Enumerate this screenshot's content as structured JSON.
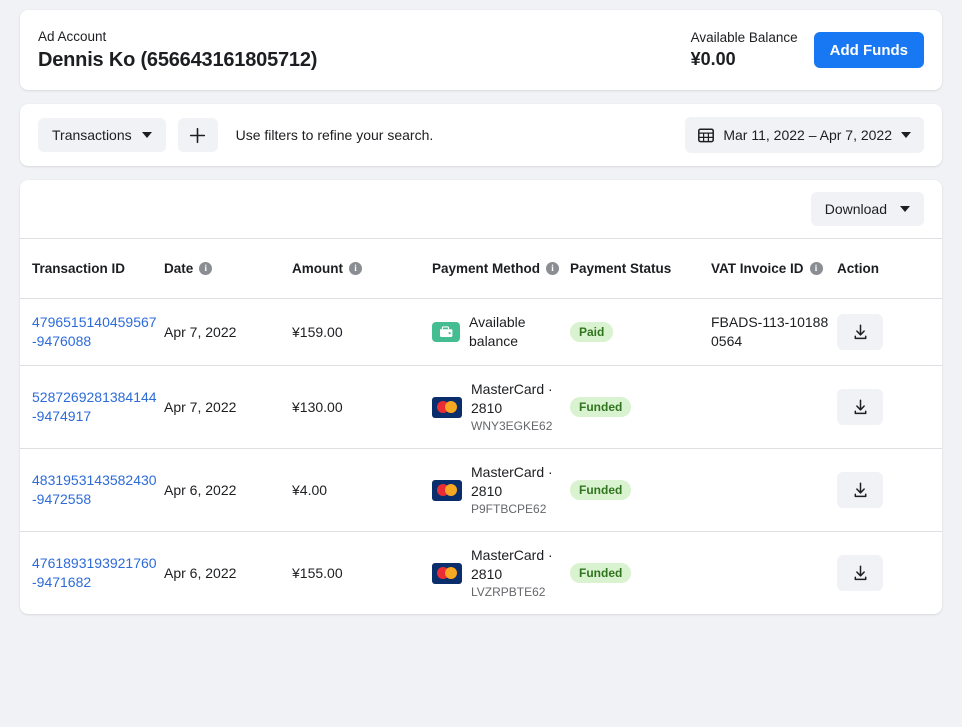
{
  "account": {
    "label": "Ad Account",
    "name": "Dennis Ko (656643161805712)",
    "balance_label": "Available Balance",
    "balance_value": "¥0.00",
    "add_funds_label": "Add Funds",
    "accent_color": "#1877f2"
  },
  "filters": {
    "type_label": "Transactions",
    "add_filter_icon": "plus-icon",
    "hint": "Use filters to refine your search.",
    "date_range": "Mar 11, 2022 – Apr 7, 2022",
    "calendar_icon": "calendar-icon"
  },
  "table": {
    "download_label": "Download",
    "columns": [
      {
        "label": "Transaction ID",
        "info": false
      },
      {
        "label": "Date",
        "info": true
      },
      {
        "label": "Amount",
        "info": true
      },
      {
        "label": "Payment Method",
        "info": true
      },
      {
        "label": "Payment Status",
        "info": false
      },
      {
        "label": "VAT Invoice ID",
        "info": true
      },
      {
        "label": "Action",
        "info": false
      }
    ],
    "info_glyph": "i",
    "action_icon": "download-icon",
    "rows": [
      {
        "transaction_id": "4796515140459567-9476088",
        "date": "Apr 7, 2022",
        "amount": "¥159.00",
        "method_icon": "wallet-icon",
        "method_name": "Available balance",
        "method_ref": "",
        "status": "Paid",
        "status_color": "#317520",
        "vat_invoice_id": "FBADS-113-101880564"
      },
      {
        "transaction_id": "5287269281384144-9474917",
        "date": "Apr 7, 2022",
        "amount": "¥130.00",
        "method_icon": "mastercard-icon",
        "method_name": "MasterCard · 2810",
        "method_ref": "WNY3EGKE62",
        "status": "Funded",
        "status_color": "#317520",
        "vat_invoice_id": ""
      },
      {
        "transaction_id": "4831953143582430-9472558",
        "date": "Apr 6, 2022",
        "amount": "¥4.00",
        "method_icon": "mastercard-icon",
        "method_name": "MasterCard · 2810",
        "method_ref": "P9FTBCPE62",
        "status": "Funded",
        "status_color": "#317520",
        "vat_invoice_id": ""
      },
      {
        "transaction_id": "4761893193921760-9471682",
        "date": "Apr 6, 2022",
        "amount": "¥155.00",
        "method_icon": "mastercard-icon",
        "method_name": "MasterCard · 2810",
        "method_ref": "LVZRPBTE62",
        "status": "Funded",
        "status_color": "#317520",
        "vat_invoice_id": ""
      }
    ]
  }
}
